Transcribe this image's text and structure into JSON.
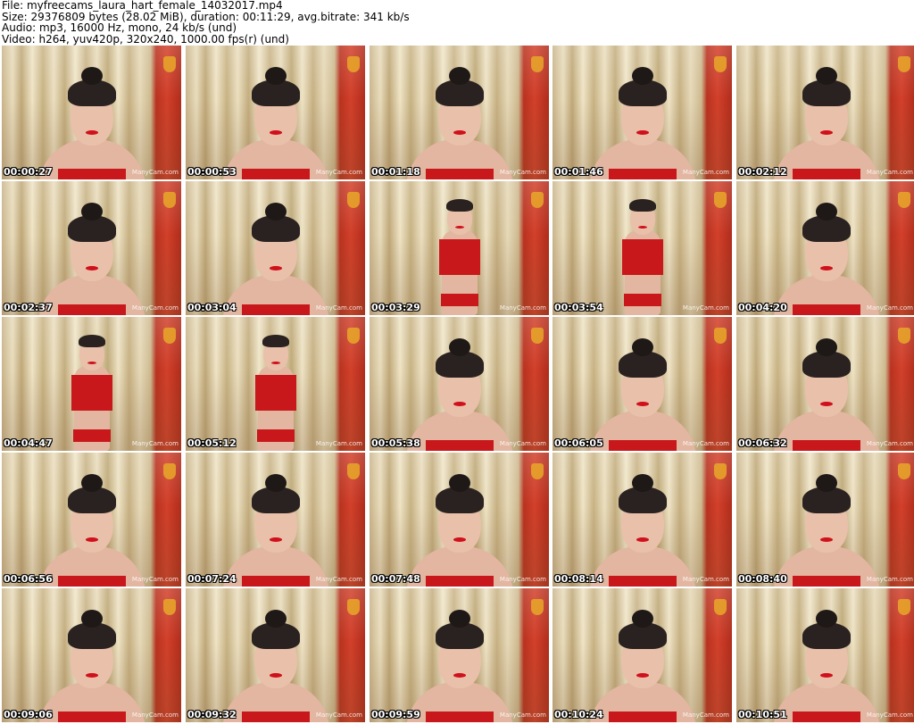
{
  "header": {
    "file_line": "File: myfreecams_laura_hart_female_14032017.mp4",
    "size_line": "Size: 29376809 bytes (28.02 MiB), duration: 00:11:29, avg.bitrate: 341 kb/s",
    "audio_line": "Audio: mp3, 16000 Hz, mono, 24 kb/s (und)",
    "video_line": "Video: h264, yuv420p, 320x240, 1000.00 fps(r) (und)"
  },
  "watermark_text": "ManyCam.com",
  "colors": {
    "curtain": "#e8dcbc",
    "wall_red": "#c8321f",
    "top_red": "#c8181c",
    "skin": "#e2b6a0",
    "hair": "#2a2220"
  },
  "thumbnails": [
    {
      "timestamp": "00:00:27",
      "scene": "closeup"
    },
    {
      "timestamp": "00:00:53",
      "scene": "closeup"
    },
    {
      "timestamp": "00:01:18",
      "scene": "closeup"
    },
    {
      "timestamp": "00:01:46",
      "scene": "closeup"
    },
    {
      "timestamp": "00:02:12",
      "scene": "closeup"
    },
    {
      "timestamp": "00:02:37",
      "scene": "closeup"
    },
    {
      "timestamp": "00:03:04",
      "scene": "closeup"
    },
    {
      "timestamp": "00:03:29",
      "scene": "full"
    },
    {
      "timestamp": "00:03:54",
      "scene": "full"
    },
    {
      "timestamp": "00:04:20",
      "scene": "closeup"
    },
    {
      "timestamp": "00:04:47",
      "scene": "full"
    },
    {
      "timestamp": "00:05:12",
      "scene": "full"
    },
    {
      "timestamp": "00:05:38",
      "scene": "closeup"
    },
    {
      "timestamp": "00:06:05",
      "scene": "closeup"
    },
    {
      "timestamp": "00:06:32",
      "scene": "closeup"
    },
    {
      "timestamp": "00:06:56",
      "scene": "closeup"
    },
    {
      "timestamp": "00:07:24",
      "scene": "closeup"
    },
    {
      "timestamp": "00:07:48",
      "scene": "closeup"
    },
    {
      "timestamp": "00:08:14",
      "scene": "closeup"
    },
    {
      "timestamp": "00:08:40",
      "scene": "closeup"
    },
    {
      "timestamp": "00:09:06",
      "scene": "closeup"
    },
    {
      "timestamp": "00:09:32",
      "scene": "closeup"
    },
    {
      "timestamp": "00:09:59",
      "scene": "closeup"
    },
    {
      "timestamp": "00:10:24",
      "scene": "closeup"
    },
    {
      "timestamp": "00:10:51",
      "scene": "closeup"
    }
  ]
}
